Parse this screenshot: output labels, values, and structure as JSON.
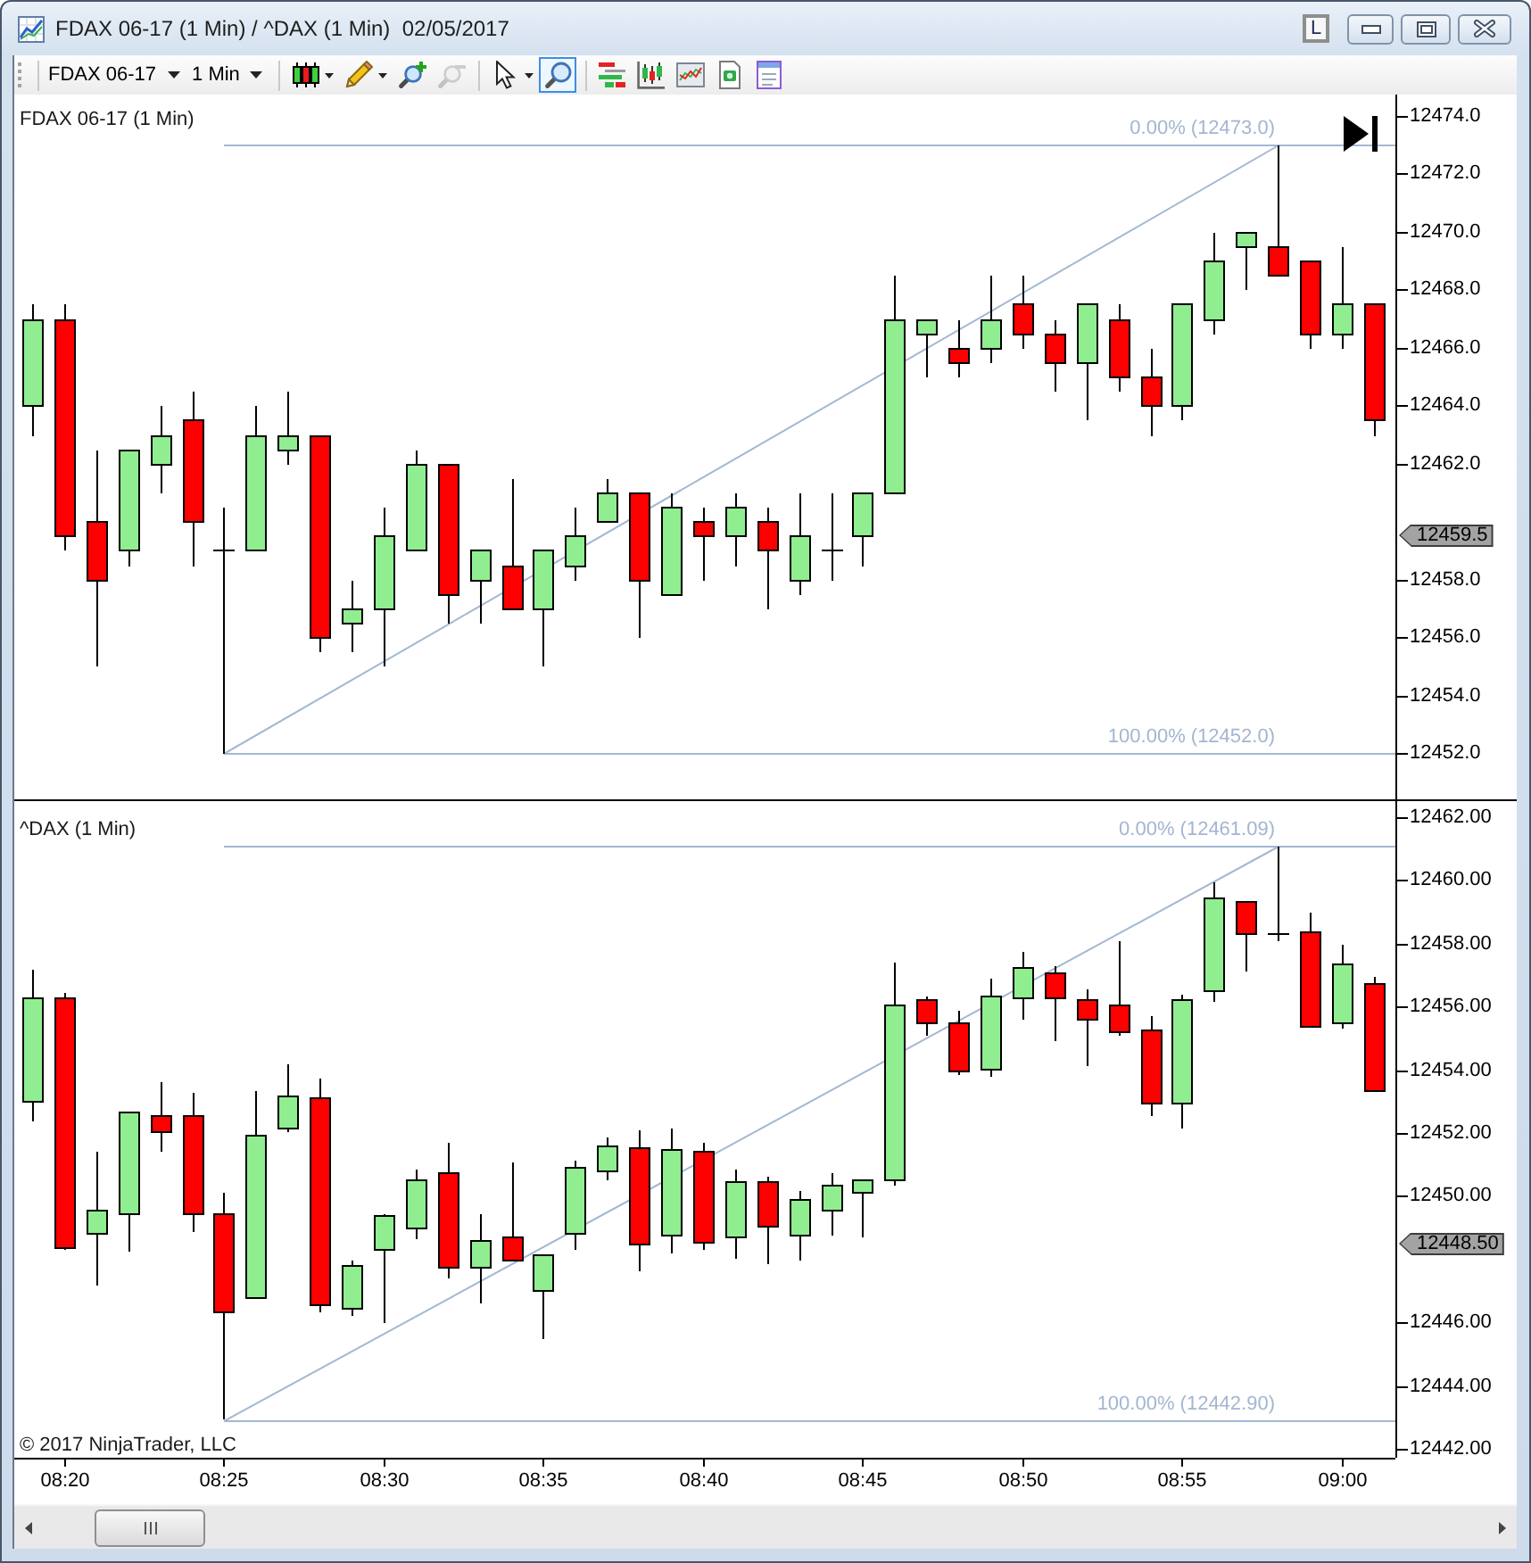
{
  "window": {
    "title": "FDAX 06-17 (1 Min) / ^DAX (1 Min)  02/05/2017",
    "link_button": "L"
  },
  "toolbar": {
    "instrument": "FDAX 06-17",
    "interval": "1 Min",
    "tool_groups": [
      {
        "tools": [
          {
            "kind": "candlestick",
            "dropdown": true,
            "selected": false,
            "disabled": false
          },
          {
            "kind": "pencil",
            "dropdown": true,
            "selected": false,
            "disabled": false
          },
          {
            "kind": "zoom-in",
            "dropdown": false,
            "selected": false,
            "disabled": false
          },
          {
            "kind": "zoom-out",
            "dropdown": false,
            "selected": false,
            "disabled": true
          }
        ]
      },
      {
        "tools": [
          {
            "kind": "pointer",
            "dropdown": true,
            "selected": false,
            "disabled": false
          },
          {
            "kind": "magnifier",
            "dropdown": false,
            "selected": true,
            "disabled": false
          }
        ]
      },
      {
        "tools": [
          {
            "kind": "bar-list"
          },
          {
            "kind": "candlestick-chart"
          },
          {
            "kind": "line-chart"
          },
          {
            "kind": "money-document"
          },
          {
            "kind": "form"
          }
        ]
      }
    ]
  },
  "panels": [
    {
      "title": "FDAX 06-17 (1 Min)",
      "end_button": true,
      "price_marker": "12459.5",
      "chart_data": {
        "type": "candlestick",
        "categories": [
          null,
          null,
          null,
          null,
          null,
          null,
          null,
          null,
          null,
          null,
          null,
          null,
          null,
          null,
          null,
          null,
          null,
          null,
          null,
          null,
          null,
          null,
          null,
          null,
          null,
          null,
          null,
          null,
          null,
          null,
          null,
          null,
          null,
          null,
          null,
          null,
          null,
          null,
          null,
          null,
          null,
          null,
          null
        ],
        "ohlc": [
          [
            12464,
            12467.5,
            12463,
            12467
          ],
          [
            12467,
            12467.5,
            12459,
            12459.5
          ],
          [
            12460,
            12462.5,
            12455,
            12458
          ],
          [
            12459,
            12462.5,
            12458.5,
            12462.5
          ],
          [
            12462,
            12464,
            12461,
            12463
          ],
          [
            12463.5,
            12464.5,
            12458.5,
            12460
          ],
          [
            12459,
            12460.5,
            12452,
            12459
          ],
          [
            12459,
            12464,
            12459,
            12463
          ],
          [
            12462.5,
            12464.5,
            12462,
            12463
          ],
          [
            12463,
            12463,
            12455.5,
            12456
          ],
          [
            12456.5,
            12458,
            12455.5,
            12457
          ],
          [
            12457,
            12460.5,
            12455,
            12459.5
          ],
          [
            12459,
            12462.5,
            12459,
            12462
          ],
          [
            12462,
            12462,
            12456.5,
            12457.5
          ],
          [
            12458,
            12459,
            12456.5,
            12459
          ],
          [
            12458.5,
            12461.5,
            12457,
            12457
          ],
          [
            12457,
            12459,
            12455,
            12459
          ],
          [
            12458.5,
            12460.5,
            12458,
            12459.5
          ],
          [
            12460,
            12461.5,
            12460,
            12461
          ],
          [
            12461,
            12461,
            12456,
            12458
          ],
          [
            12457.5,
            12461,
            12457.5,
            12460.5
          ],
          [
            12460,
            12460.5,
            12458,
            12459.5
          ],
          [
            12459.5,
            12461,
            12458.5,
            12460.5
          ],
          [
            12460,
            12460.5,
            12457,
            12459
          ],
          [
            12458,
            12461,
            12457.5,
            12459.5
          ],
          [
            12459,
            12461,
            12458,
            12459
          ],
          [
            12459.5,
            12461,
            12458.5,
            12461
          ],
          [
            12461,
            12468.5,
            12461,
            12467
          ],
          [
            12466.5,
            12467,
            12465,
            12467
          ],
          [
            12466,
            12467,
            12465,
            12465.5
          ],
          [
            12466,
            12468.5,
            12465.5,
            12467
          ],
          [
            12467.5,
            12468.5,
            12466,
            12466.5
          ],
          [
            12466.5,
            12467,
            12464.5,
            12465.5
          ],
          [
            12465.5,
            12467.5,
            12463.5,
            12467.5
          ],
          [
            12467,
            12467.5,
            12464.5,
            12465
          ],
          [
            12465,
            12466,
            12463,
            12464
          ],
          [
            12464,
            12467.5,
            12463.5,
            12467.5
          ],
          [
            12467,
            12470,
            12466.5,
            12469
          ],
          [
            12469.5,
            12470,
            12468,
            12470
          ],
          [
            12469.5,
            12473,
            12468.5,
            12468.5
          ],
          [
            12469,
            12469,
            12466,
            12466.5
          ],
          [
            12466.5,
            12469.5,
            12466,
            12467.5
          ],
          [
            12467.5,
            12467.5,
            12463,
            12463.5
          ]
        ],
        "ylim": [
          12450.4,
          12474.74
        ],
        "yticks": [
          {
            "value": 12474,
            "label": "12474.0"
          },
          {
            "value": 12472,
            "label": "12472.0"
          },
          {
            "value": 12470,
            "label": "12470.0"
          },
          {
            "value": 12468,
            "label": "12468.0"
          },
          {
            "value": 12466,
            "label": "12466.0"
          },
          {
            "value": 12464,
            "label": "12464.0"
          },
          {
            "value": 12462,
            "label": "12462.0"
          },
          {
            "value": 12458,
            "label": "12458.0"
          },
          {
            "value": 12456,
            "label": "12456.0"
          },
          {
            "value": 12454,
            "label": "12454.0"
          },
          {
            "value": 12452,
            "label": "12452.0"
          }
        ],
        "ref_lines": [
          {
            "axis": "y",
            "value": 12473.0,
            "label": "0.00% (12473.0)"
          },
          {
            "axis": "y",
            "value": 12452.0,
            "label": "100.00% (12452.0)"
          }
        ]
      }
    },
    {
      "title": "^DAX (1 Min)",
      "end_button": false,
      "price_marker": "12448.50",
      "chart_data": {
        "type": "candlestick",
        "categories": [
          null,
          "08:20",
          null,
          null,
          null,
          null,
          "08:25",
          null,
          null,
          null,
          null,
          "08:30",
          null,
          null,
          null,
          null,
          "08:35",
          null,
          null,
          null,
          null,
          "08:40",
          null,
          null,
          null,
          null,
          "08:45",
          null,
          null,
          null,
          null,
          "08:50",
          null,
          null,
          null,
          null,
          "08:55",
          null,
          null,
          null,
          null,
          "09:00",
          null
        ],
        "ohlc": [
          [
            12453.02,
            12457.2,
            12452.4,
            12456.29
          ],
          [
            12456.29,
            12456.46,
            12448.33,
            12448.38
          ],
          [
            12448.84,
            12451.44,
            12447.2,
            12449.57
          ],
          [
            12449.46,
            12452.68,
            12448.27,
            12452.68
          ],
          [
            12452.56,
            12453.64,
            12451.44,
            12452.06
          ],
          [
            12452.56,
            12453.3,
            12448.89,
            12449.46
          ],
          [
            12449.46,
            12450.14,
            12442.96,
            12446.35
          ],
          [
            12446.8,
            12453.36,
            12446.8,
            12451.94
          ],
          [
            12452.17,
            12454.2,
            12452.06,
            12453.19
          ],
          [
            12453.13,
            12453.75,
            12446.35,
            12446.58
          ],
          [
            12446.46,
            12447.99,
            12446.24,
            12447.82
          ],
          [
            12448.33,
            12449.46,
            12446.01,
            12449.4
          ],
          [
            12449.01,
            12450.87,
            12448.67,
            12450.53
          ],
          [
            12450.76,
            12451.72,
            12447.42,
            12447.76
          ],
          [
            12447.76,
            12449.46,
            12446.63,
            12448.61
          ],
          [
            12448.72,
            12451.1,
            12447.99,
            12447.99
          ],
          [
            12447.03,
            12448.16,
            12445.5,
            12448.16
          ],
          [
            12448.84,
            12451.15,
            12448.33,
            12450.93
          ],
          [
            12450.81,
            12451.89,
            12450.53,
            12451.6
          ],
          [
            12451.55,
            12452.11,
            12447.65,
            12448.5
          ],
          [
            12448.78,
            12452.17,
            12448.21,
            12451.49
          ],
          [
            12451.44,
            12451.72,
            12448.33,
            12448.55
          ],
          [
            12448.72,
            12450.87,
            12448.05,
            12450.47
          ],
          [
            12450.47,
            12450.64,
            12447.88,
            12449.06
          ],
          [
            12448.78,
            12450.19,
            12447.99,
            12449.91
          ],
          [
            12449.57,
            12450.76,
            12448.78,
            12450.36
          ],
          [
            12450.14,
            12450.53,
            12448.72,
            12450.53
          ],
          [
            12450.53,
            12457.42,
            12450.36,
            12456.07
          ],
          [
            12456.24,
            12456.35,
            12455.11,
            12455.5
          ],
          [
            12455.5,
            12455.9,
            12453.86,
            12453.98
          ],
          [
            12454.03,
            12456.92,
            12453.81,
            12456.35
          ],
          [
            12456.29,
            12457.76,
            12455.62,
            12457.25
          ],
          [
            12457.08,
            12457.31,
            12454.94,
            12456.29
          ],
          [
            12456.24,
            12456.58,
            12454.15,
            12455.62
          ],
          [
            12456.07,
            12458.1,
            12455.11,
            12455.22
          ],
          [
            12455.28,
            12455.73,
            12452.56,
            12452.96
          ],
          [
            12452.96,
            12456.41,
            12452.17,
            12456.24
          ],
          [
            12456.52,
            12459.97,
            12456.18,
            12459.46
          ],
          [
            12459.34,
            12459.34,
            12457.14,
            12458.33
          ],
          [
            12458.33,
            12461.1,
            12458.1,
            12458.33
          ],
          [
            12458.38,
            12459.01,
            12455.39,
            12455.39
          ],
          [
            12455.5,
            12457.99,
            12455.33,
            12457.37
          ],
          [
            12456.75,
            12456.97,
            12453.36,
            12453.36
          ]
        ],
        "ylim": [
          12441.72,
          12462.51
        ],
        "yticks": [
          {
            "value": 12462,
            "label": "12462.00"
          },
          {
            "value": 12460,
            "label": "12460.00"
          },
          {
            "value": 12458,
            "label": "12458.00"
          },
          {
            "value": 12456,
            "label": "12456.00"
          },
          {
            "value": 12454,
            "label": "12454.00"
          },
          {
            "value": 12452,
            "label": "12452.00"
          },
          {
            "value": 12450,
            "label": "12450.00"
          },
          {
            "value": 12446,
            "label": "12446.00"
          },
          {
            "value": 12444,
            "label": "12444.00"
          },
          {
            "value": 12442,
            "label": "12442.00"
          }
        ],
        "ref_lines": [
          {
            "axis": "y",
            "value": 12461.09,
            "label": "0.00% (12461.09)"
          },
          {
            "axis": "y",
            "value": 12442.9,
            "label": "100.00% (12442.90)"
          }
        ]
      }
    }
  ],
  "copyright": "© 2017 NinjaTrader, LLC"
}
